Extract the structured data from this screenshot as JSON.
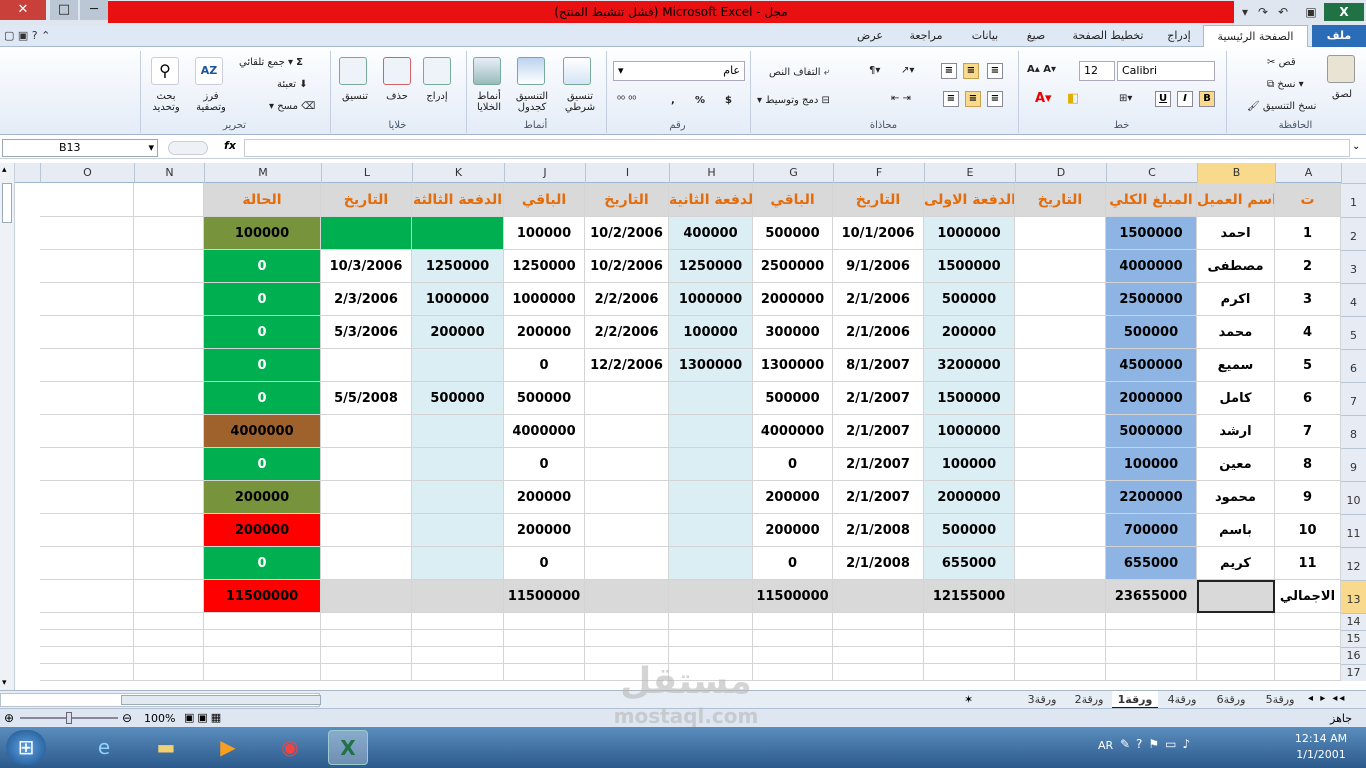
{
  "window": {
    "title": "مجل - Microsoft Excel (فشل تنشيط المنتج)"
  },
  "menu": {
    "file": "ملف",
    "tabs": [
      "الصفحة الرئيسية",
      "إدراج",
      "تخطيط الصفحة",
      "صيغ",
      "بيانات",
      "مراجعة",
      "عرض"
    ]
  },
  "ribbon": {
    "clipboard": {
      "label": "الحافظة",
      "paste": "لصق",
      "cut": "قص",
      "copy": "نسخ",
      "format_painter": "نسخ التنسيق"
    },
    "font": {
      "label": "خط",
      "name": "Calibri",
      "size": "12"
    },
    "alignment": {
      "label": "محاذاة",
      "wrap": "التفاف النص",
      "merge": "دمج وتوسيط"
    },
    "number": {
      "label": "رقم",
      "format": "عام",
      "percent": "%",
      "currency": "$",
      "comma": ","
    },
    "styles": {
      "label": "أنماط",
      "conditional": "تنسيق شرطي",
      "table": "التنسيق كجدول",
      "cell": "أنماط الخلايا"
    },
    "cells": {
      "label": "خلايا",
      "insert": "إدراج",
      "delete": "حذف",
      "format": "تنسيق"
    },
    "editing": {
      "label": "تحرير",
      "autosum": "جمع تلقائي",
      "fill": "تعبئة",
      "clear": "مسح",
      "sort": "فرز وتصفية",
      "find": "بحث وتحديد"
    }
  },
  "formula_bar": {
    "name_box": "B13",
    "fx": "fx",
    "value": ""
  },
  "columns": [
    "A",
    "B",
    "C",
    "D",
    "E",
    "F",
    "G",
    "H",
    "I",
    "J",
    "K",
    "L",
    "M",
    "N",
    "O"
  ],
  "selected_column": "B",
  "selected_row": "13",
  "rows": [
    "1",
    "2",
    "3",
    "4",
    "5",
    "6",
    "7",
    "8",
    "9",
    "10",
    "11",
    "12",
    "13",
    "14",
    "15",
    "16",
    "17"
  ],
  "headers": [
    "ت",
    "اسم العميل",
    "المبلغ الكلي",
    "التاريخ",
    "الدفعة الاولى",
    "التاريخ",
    "الباقي",
    "الدفعة الثانية",
    "التاريخ",
    "الباقي",
    "الدفعة الثالثة",
    "التاريخ",
    "الحالة"
  ],
  "data": [
    [
      "1",
      "احمد",
      "1500000",
      "",
      "1000000",
      "10/1/2006",
      "500000",
      "400000",
      "10/2/2006",
      "100000",
      "",
      "",
      "100000"
    ],
    [
      "2",
      "مصطفى",
      "4000000",
      "",
      "1500000",
      "9/1/2006",
      "2500000",
      "1250000",
      "10/2/2006",
      "1250000",
      "1250000",
      "10/3/2006",
      "0"
    ],
    [
      "3",
      "اكرم",
      "2500000",
      "",
      "500000",
      "2/1/2006",
      "2000000",
      "1000000",
      "2/2/2006",
      "1000000",
      "1000000",
      "2/3/2006",
      "0"
    ],
    [
      "4",
      "محمد",
      "500000",
      "",
      "200000",
      "2/1/2006",
      "300000",
      "100000",
      "2/2/2006",
      "200000",
      "200000",
      "5/3/2006",
      "0"
    ],
    [
      "5",
      "سميع",
      "4500000",
      "",
      "3200000",
      "8/1/2007",
      "1300000",
      "1300000",
      "12/2/2006",
      "0",
      "",
      "",
      "0"
    ],
    [
      "6",
      "كامل",
      "2000000",
      "",
      "1500000",
      "2/1/2007",
      "500000",
      "",
      "",
      "500000",
      "500000",
      "5/5/2008",
      "0"
    ],
    [
      "7",
      "ارشد",
      "5000000",
      "",
      "1000000",
      "2/1/2007",
      "4000000",
      "",
      "",
      "4000000",
      "",
      "",
      "4000000"
    ],
    [
      "8",
      "معين",
      "100000",
      "",
      "100000",
      "2/1/2007",
      "0",
      "",
      "",
      "0",
      "",
      "",
      "0"
    ],
    [
      "9",
      "محمود",
      "2200000",
      "",
      "2000000",
      "2/1/2007",
      "200000",
      "",
      "",
      "200000",
      "",
      "",
      "200000"
    ],
    [
      "10",
      "باسم",
      "700000",
      "",
      "500000",
      "2/1/2008",
      "200000",
      "",
      "",
      "200000",
      "",
      "",
      "200000"
    ],
    [
      "11",
      "كريم",
      "655000",
      "",
      "655000",
      "2/1/2008",
      "0",
      "",
      "",
      "0",
      "",
      "",
      "0"
    ]
  ],
  "status_colors": [
    "#77933c",
    "#00b050",
    "#00b050",
    "#00b050",
    "#00b050",
    "#00b050",
    "#a0622d",
    "#00b050",
    "#77933c",
    "#ff0000",
    "#00b050"
  ],
  "totals": {
    "label": "الاجمالي",
    "total": "23655000",
    "first": "12155000",
    "rem1": "11500000",
    "rem2": "11500000",
    "status": "11500000",
    "status_color": "#ff0000"
  },
  "sheets": [
    "ورقة5",
    "ورقة6",
    "ورقة4",
    "ورقة1",
    "ورقة2",
    "ورقة3"
  ],
  "active_sheet": "ورقة1",
  "status": {
    "ready": "جاهز",
    "zoom": "100%"
  },
  "taskbar": {
    "lang": "AR",
    "time": "12:14 AM",
    "date": "1/1/2001"
  },
  "watermark": {
    "ar": "مستقل",
    "en": "mostaql.com"
  }
}
